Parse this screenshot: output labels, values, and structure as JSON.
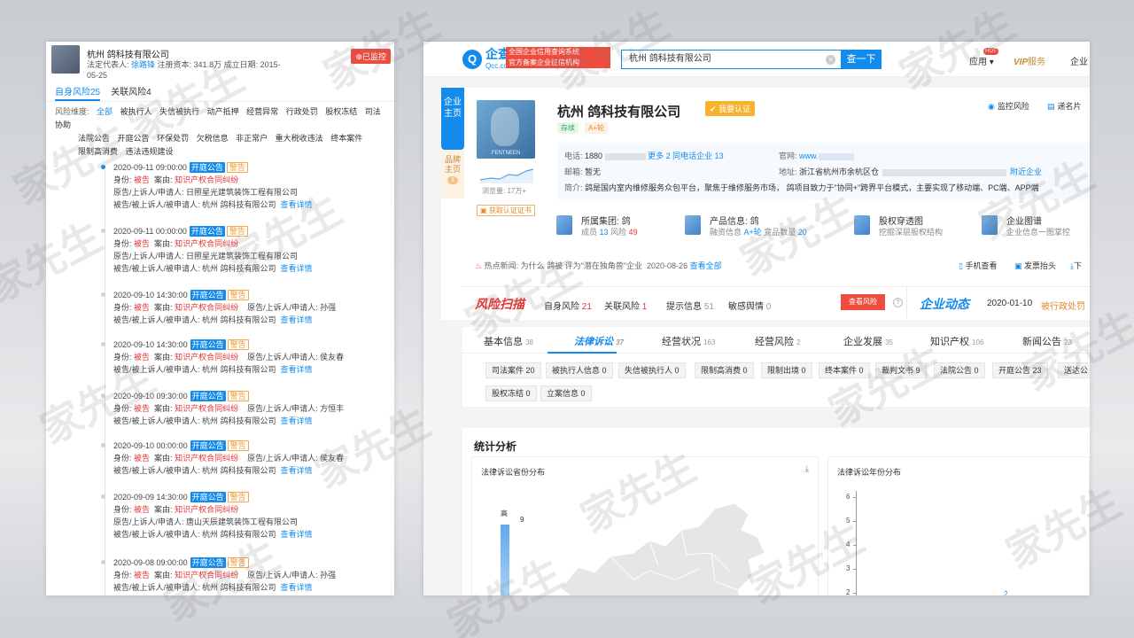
{
  "left": {
    "company": "杭州    鸽科技有限公司",
    "legal_rep_label": "法定代表人: ",
    "legal_rep": "徐路锋",
    "capital": "注册资本: 341.8万",
    "founded": "成立日期: 2015-05-25",
    "monitor": "已监控",
    "tabs": [
      "自身风险25",
      "关联风险4"
    ],
    "filter_label": "风险维度:",
    "filters_row1": [
      "全部",
      "被执行人",
      "失信被执行",
      "动产抵押",
      "经营异常",
      "行政处罚",
      "股权冻结",
      "司法协助"
    ],
    "filters_row2": [
      "法院公告",
      "开庭公告",
      "环保处罚",
      "欠税信息",
      "非正常户",
      "重大税收违法",
      "终本案件"
    ],
    "filters_row3": [
      "限制高消费",
      "违法违规建设"
    ],
    "tag_open": "开庭公告",
    "tag_warn": "警告",
    "l_identity": "身份: ",
    "l_case": "案由: ",
    "identity": "被告",
    "cause": "知识产权合同纠纷",
    "l_plaintiff": "原告/上诉人/申请人: ",
    "l_defendant": "被告/被上诉人/被申请人: ",
    "defendant": "杭州    鸽科技有限公司",
    "detail": "查看详情",
    "items": [
      {
        "date": "2020-09-11 09:00:00",
        "plaintiff": "日照星光建筑装饰工程有限公司"
      },
      {
        "date": "2020-09-11 00:00:00",
        "plaintiff": "日照星光建筑装饰工程有限公司"
      },
      {
        "date": "2020-09-10 14:30:00",
        "plaintiff": "孙强"
      },
      {
        "date": "2020-09-10 14:30:00",
        "plaintiff": "侯友春"
      },
      {
        "date": "2020-09-10 09:30:00",
        "plaintiff": "方恒丰"
      },
      {
        "date": "2020-09-10 00:00:00",
        "plaintiff": "侯友春"
      },
      {
        "date": "2020-09-09 14:30:00",
        "plaintiff": "唐山天辰建筑装饰工程有限公司"
      },
      {
        "date": "2020-09-08 09:00:00",
        "plaintiff": "孙强"
      }
    ]
  },
  "right": {
    "logo_cn": "企查查",
    "logo_en": "Qcc.com",
    "logo_badge_1": "全国企业信用查询系统",
    "logo_badge_2": "官方备案企业征信机构",
    "search_value": "杭州    鸽科技有限公司",
    "search_btn": "查一下",
    "nav_app": "应用",
    "nav_hot": "HOT",
    "nav_vip": "VIP",
    "nav_vip_service": "服务",
    "nav_ent": "企业",
    "side_tab": "企业主页",
    "side_tab2": "品牌主页",
    "side_tab2_num": "1",
    "views": "浏览量: 17万+",
    "cert_btn": "获取认证证书",
    "avatar_caption": "FENTNEEN",
    "company": "杭州    鸽科技有限公司",
    "verify": "我要认证",
    "status": "存续",
    "round": "A+轮",
    "monitor_risk": "监控风险",
    "card": "递名片",
    "phone_k": "电话: ",
    "phone_v": "1880",
    "more": "更多 2",
    "same_phone": "同电话企业 13",
    "website_k": "官网: ",
    "website_v": "www.",
    "email_k": "邮箱: ",
    "email_v": "暂无",
    "addr_k": "地址: ",
    "addr_v": "浙江省杭州市余杭区仓",
    "nearby": "附近企业",
    "intro_k": "简介: ",
    "intro_v": "鸽是国内室内维修服务众包平台，聚焦于维修服务市场，   鸽项目致力于\"协同+\"跨界平台模式，主要实现了移动端、PC端、APP端",
    "modules": [
      {
        "t1": "所属集团:",
        "t1v": "鸽",
        "t2": "成员 ",
        "t2n": "13",
        "t3": " 风险 ",
        "t3n": "49"
      },
      {
        "t1": "产品信息:",
        "t1v": "鸽",
        "t2": "融资信息 ",
        "t2n": "A+轮",
        "t3": " 竞品数量 ",
        "t3n": "20"
      },
      {
        "t1": "股权穿透图",
        "t1v": "",
        "t2": "挖掘深层股权结构",
        "t2n": "",
        "t3": "",
        "t3n": ""
      },
      {
        "t1": "企业图谱",
        "t1v": "",
        "t2": "企业信息一图掌控",
        "t2n": "",
        "t3": "",
        "t3n": ""
      }
    ],
    "hot_label": "热点新闻: ",
    "hot_text": "为什么    鸽被   评为\"潜在独角兽\"企业",
    "hot_date": "2020-08-26",
    "hot_all": "查看全部",
    "mobile": "手机查看",
    "feedback": "发票抬头",
    "download": "下",
    "risk_title": "风险扫描",
    "risk_self": "自身风险",
    "risk_self_n": "21",
    "risk_rel": "关联风险",
    "risk_rel_n": "1",
    "risk_hint": "提示信息",
    "risk_hint_n": "51",
    "risk_sens": "敏感舆情",
    "risk_sens_n": "0",
    "risk_btn": "查看风险",
    "help": "?",
    "dyn_title": "企业动态",
    "dyn_date": "2020-01-10",
    "dyn_event": "被行政处罚",
    "tabs": [
      {
        "label": "基本信息",
        "count": "38"
      },
      {
        "label": "法律诉讼",
        "count": "37"
      },
      {
        "label": "经营状况",
        "count": "163"
      },
      {
        "label": "经营风险",
        "count": "2"
      },
      {
        "label": "企业发展",
        "count": "35"
      },
      {
        "label": "知识产权",
        "count": "106"
      },
      {
        "label": "新闻公告",
        "count": "23"
      }
    ],
    "chips_row1": [
      "司法案件 20",
      "被执行人信息 0",
      "失信被执行人 0",
      "限制高消费 0",
      "限制出境 0",
      "终本案件 0",
      "裁判文书 9",
      "法院公告 0",
      "开庭公告 23",
      "送达公"
    ],
    "chips_row2": [
      "股权冻结 0",
      "立案信息 0"
    ],
    "stat_title": "统计分析",
    "chart1_title": "法律诉讼省份分布",
    "chart1_download": "⤓",
    "chart1_legend_hi": "高",
    "chart1_legend_val": "9",
    "chart2_title": "法律诉讼年份分布",
    "chart2_yticks": [
      "6",
      "5",
      "4",
      "3",
      "2"
    ],
    "chart2_bar_label": "2"
  },
  "watermark": "家先生"
}
